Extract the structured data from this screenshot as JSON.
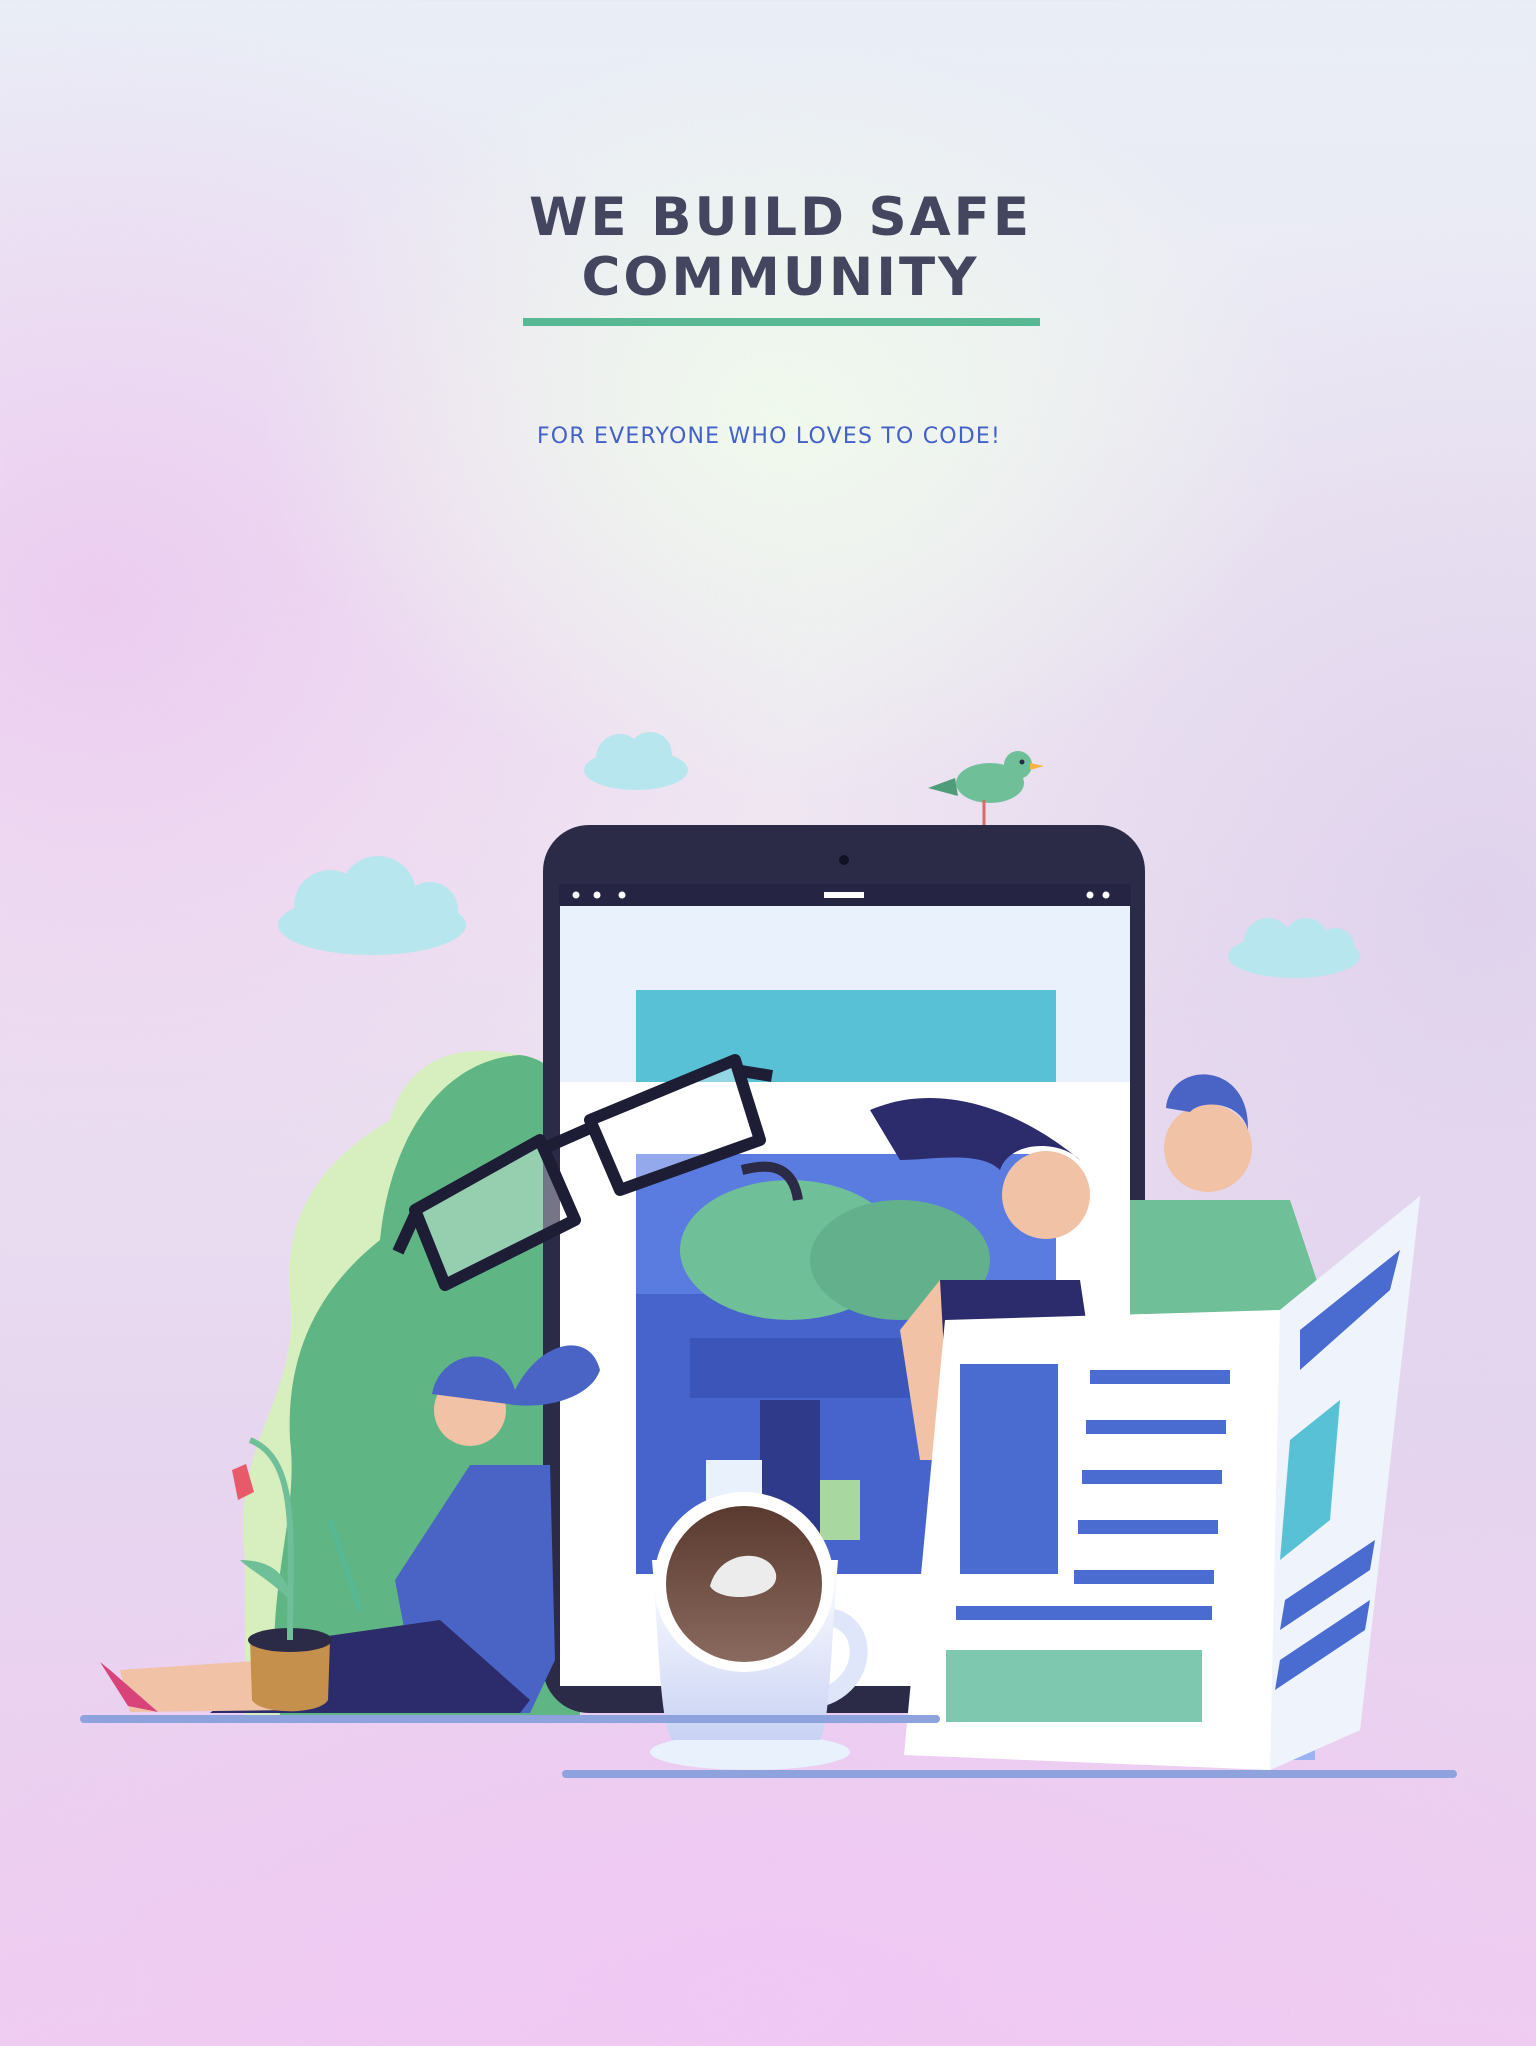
{
  "hero": {
    "title_line_1": "WE BUILD SAFE",
    "title_line_2": "COMMUNITY",
    "subtitle": "FOR EVERYONE WHO LOVES TO CODE!"
  },
  "colors": {
    "title": "#43465e",
    "accent_underline": "#57b893",
    "subtitle": "#4361c9",
    "tablet": "#2c2b47",
    "cloud": "#b8e6ee",
    "bush": "#5fb584",
    "newspaper_blue": "#4a6cd0"
  },
  "illustration": {
    "icons": [
      "cloud-icon",
      "bird-icon",
      "tablet-icon",
      "glasses-icon",
      "coffee-cup-icon",
      "newspaper-icon",
      "plant-icon",
      "bush-icon"
    ]
  }
}
